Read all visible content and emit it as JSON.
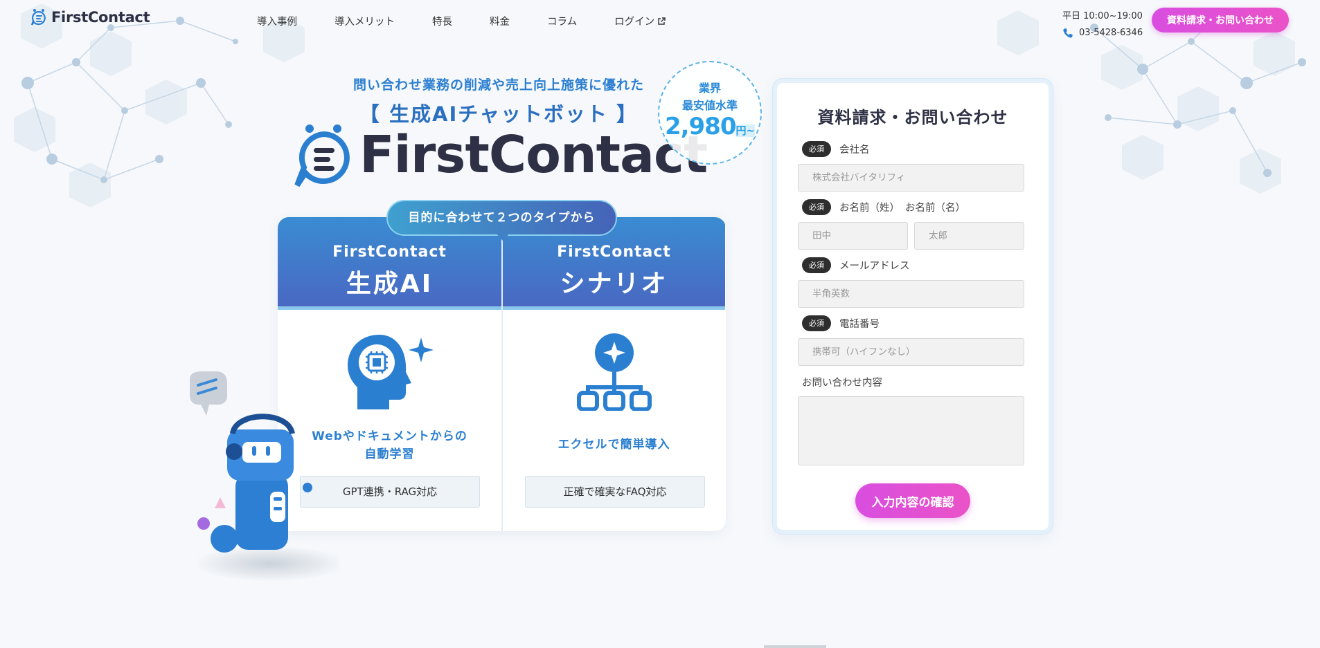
{
  "header": {
    "logo_text": "FirstContact",
    "nav": [
      {
        "label": "導入事例"
      },
      {
        "label": "導入メリット"
      },
      {
        "label": "特長"
      },
      {
        "label": "料金"
      },
      {
        "label": "コラム"
      },
      {
        "label": "ログイン"
      }
    ],
    "hours": "平日 10:00~19:00",
    "phone": "03-5428-6346",
    "cta": "資料請求・お問い合わせ"
  },
  "hero": {
    "tagline": "問い合わせ業務の削減や売上向上施策に優れた",
    "subtitle": "【 生成AIチャットボット 】",
    "logo_text": "FirstContact",
    "badge": {
      "line1": "業界",
      "line2": "最安値水準",
      "price": "2,980",
      "unit": "円~"
    },
    "type_pill": "目的に合わせて２つのタイプから"
  },
  "cards": [
    {
      "brand": "FirstContact",
      "name": "生成AI",
      "desc_line1": "Webやドキュメントからの",
      "desc_line2": "自動学習",
      "tag": "GPT連携・RAG対応"
    },
    {
      "brand": "FirstContact",
      "name": "シナリオ",
      "desc_line1": "エクセルで簡単導入",
      "tag": "正確で確実なFAQ対応"
    }
  ],
  "form": {
    "title": "資料請求・お問い合わせ",
    "required": "必須",
    "company_label": "会社名",
    "company_placeholder": "株式会社バイタリフィ",
    "lastname_label": "お名前（姓）",
    "firstname_label": "お名前（名）",
    "lastname_placeholder": "田中",
    "firstname_placeholder": "太郎",
    "email_label": "メールアドレス",
    "email_placeholder": "半角英数",
    "phone_label": "電話番号",
    "phone_placeholder": "携帯可（ハイフンなし）",
    "message_label": "お問い合わせ内容",
    "submit": "入力内容の確認"
  },
  "colors": {
    "accent_pink": "#d94ee0",
    "brand_blue": "#2b7fd1",
    "dark": "#2e3145"
  }
}
